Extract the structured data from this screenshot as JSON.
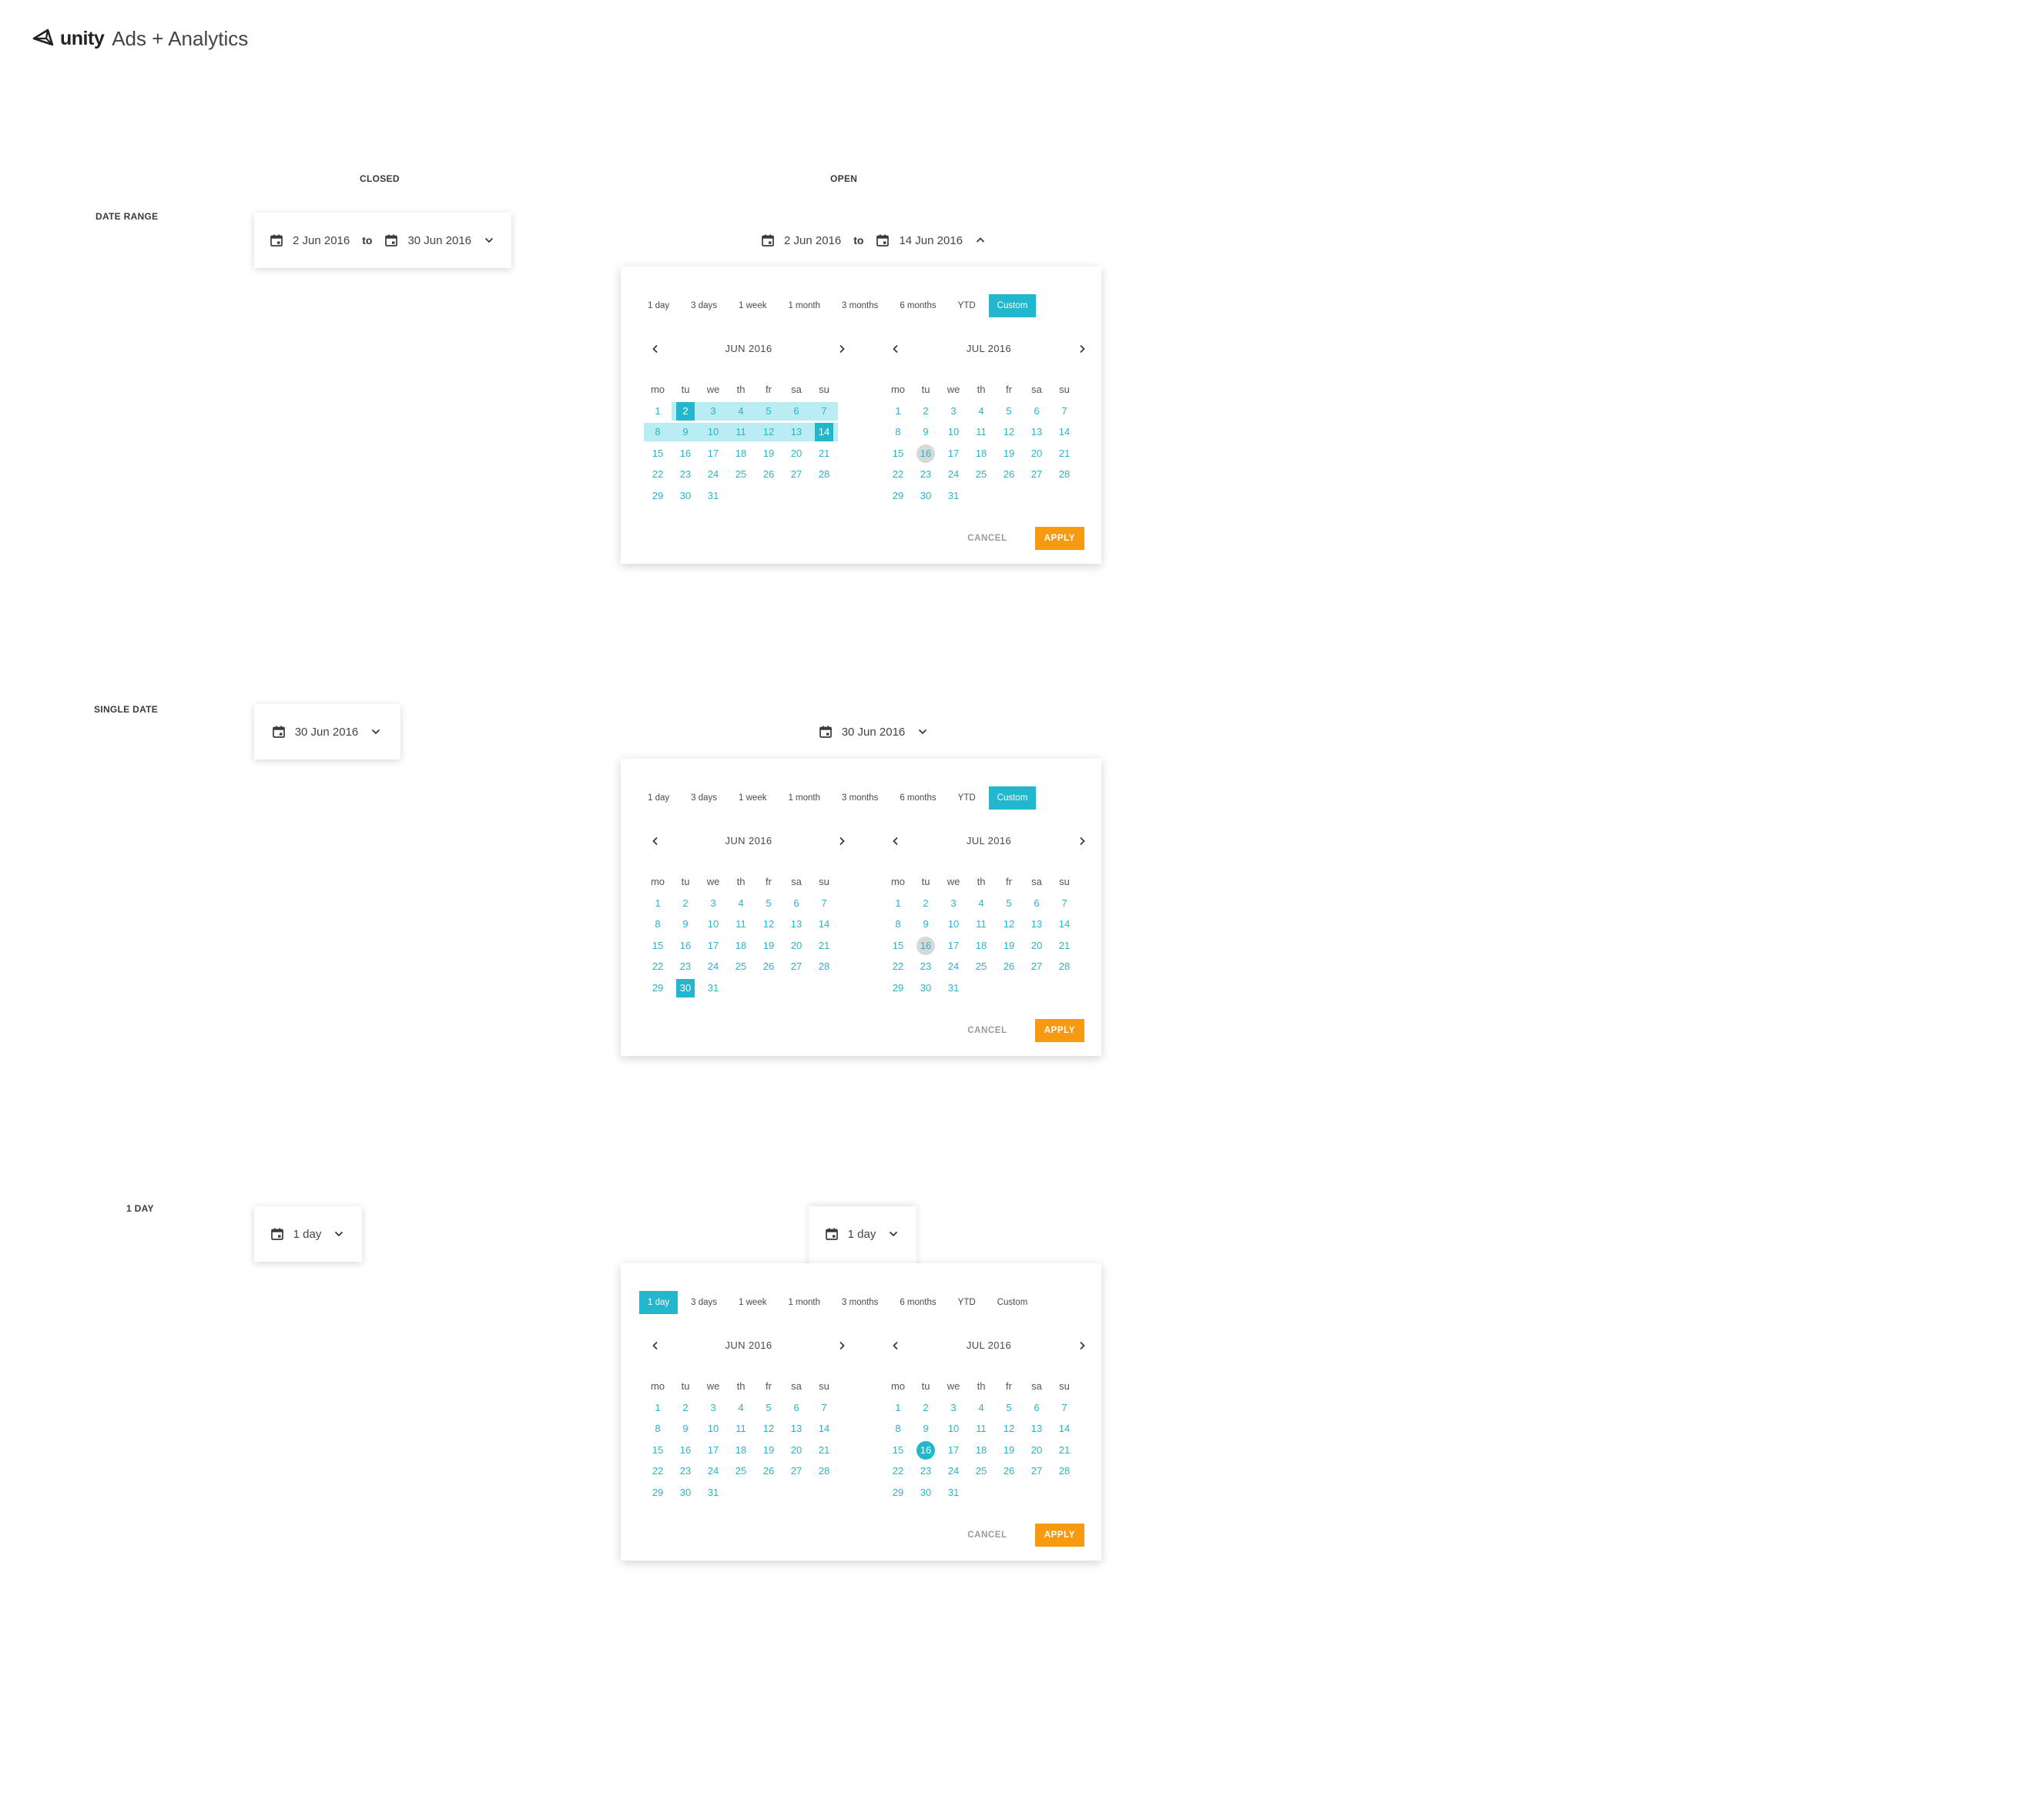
{
  "app": {
    "brand": "unity",
    "product": "Ads + Analytics"
  },
  "columns": {
    "closed": "CLOSED",
    "open": "OPEN"
  },
  "rows": {
    "date_range": "DATE RANGE",
    "single_date": "SINGLE DATE",
    "one_day": "1 DAY"
  },
  "closed_date_range": {
    "from": "2 Jun 2016",
    "to_word": "to",
    "to": "30 Jun 2016"
  },
  "open_date_range": {
    "from": "2 Jun 2016",
    "to_word": "to",
    "to": "14 Jun 2016"
  },
  "closed_single": {
    "date": "30 Jun 2016"
  },
  "open_single": {
    "date": "30 Jun 2016"
  },
  "closed_day": {
    "label": "1 day"
  },
  "open_day": {
    "label": "1 day"
  },
  "presets": [
    "1 day",
    "3 days",
    "1 week",
    "1 month",
    "3 months",
    "6 months",
    "YTD",
    "Custom"
  ],
  "weekdays": [
    "mo",
    "tu",
    "we",
    "th",
    "fr",
    "sa",
    "su"
  ],
  "months": {
    "jun": "JUN 2016",
    "jul": "JUL 2016"
  },
  "actions": {
    "cancel": "CANCEL",
    "apply": "APPLY"
  },
  "calendar_rules": {
    "jun_first_weekday_index": 2,
    "jul_first_weekday_index": 4,
    "days_in_jun": 30,
    "days_in_jul": 31,
    "jun_display_days": 31,
    "jul_display_days": 31
  },
  "panels": [
    {
      "active_preset": "Custom",
      "range": {
        "month": "jun",
        "start": 2,
        "end": 14
      },
      "selected": [
        {
          "month": "jun",
          "day": 2
        },
        {
          "month": "jun",
          "day": 14
        }
      ],
      "today": {
        "month": "jul",
        "day": 16,
        "highlight": "grey"
      }
    },
    {
      "active_preset": "Custom",
      "range": null,
      "selected": [
        {
          "month": "jun",
          "day": 30
        }
      ],
      "today": {
        "month": "jul",
        "day": 16,
        "highlight": "grey"
      }
    },
    {
      "active_preset": "1 day",
      "range": null,
      "selected": [],
      "today": {
        "month": "jul",
        "day": 16,
        "highlight": "accent"
      }
    }
  ],
  "colors": {
    "accent": "#22b7cd",
    "range_band": "#b9ecf3",
    "apply": "#f79a0f",
    "today_grey": "#d8d8d8"
  }
}
